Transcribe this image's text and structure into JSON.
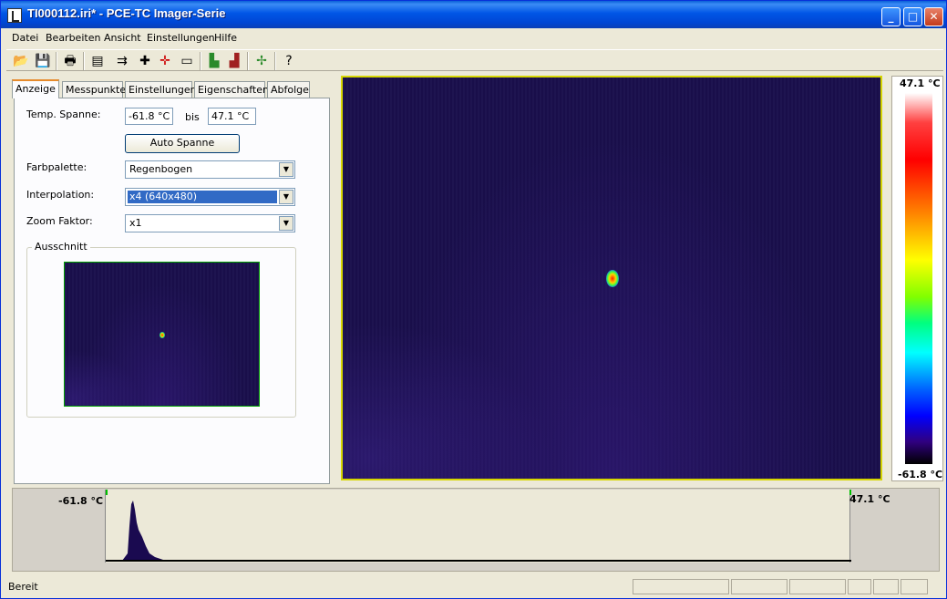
{
  "window": {
    "title": "TI000112.iri* - PCE-TC Imager-Serie"
  },
  "menu": {
    "items": [
      "Datei",
      "Bearbeiten",
      "Ansicht",
      "Einstellungen",
      "Hilfe"
    ]
  },
  "tabs": [
    "Anzeige",
    "Messpunkte",
    "Einstellungen",
    "Eigenschaften",
    "Abfolge"
  ],
  "display": {
    "temp_range_label": "Temp. Spanne:",
    "temp_min": "-61.8 °C",
    "bis_label": "bis",
    "temp_max": "47.1 °C",
    "auto_span_button": "Auto Spanne",
    "palette_label": "Farbpalette:",
    "palette_value": "Regenbogen",
    "interpolation_label": "Interpolation:",
    "interpolation_value": "x4 (640x480)",
    "zoom_label": "Zoom Faktor:",
    "zoom_value": "x1",
    "crop_label": "Ausschnitt"
  },
  "scale": {
    "max": "47.1 °C",
    "min": "-61.8 °C"
  },
  "histogram": {
    "min_label": "-61.8 °C",
    "max_label": "47.1 °C"
  },
  "status": {
    "text": "Bereit"
  }
}
